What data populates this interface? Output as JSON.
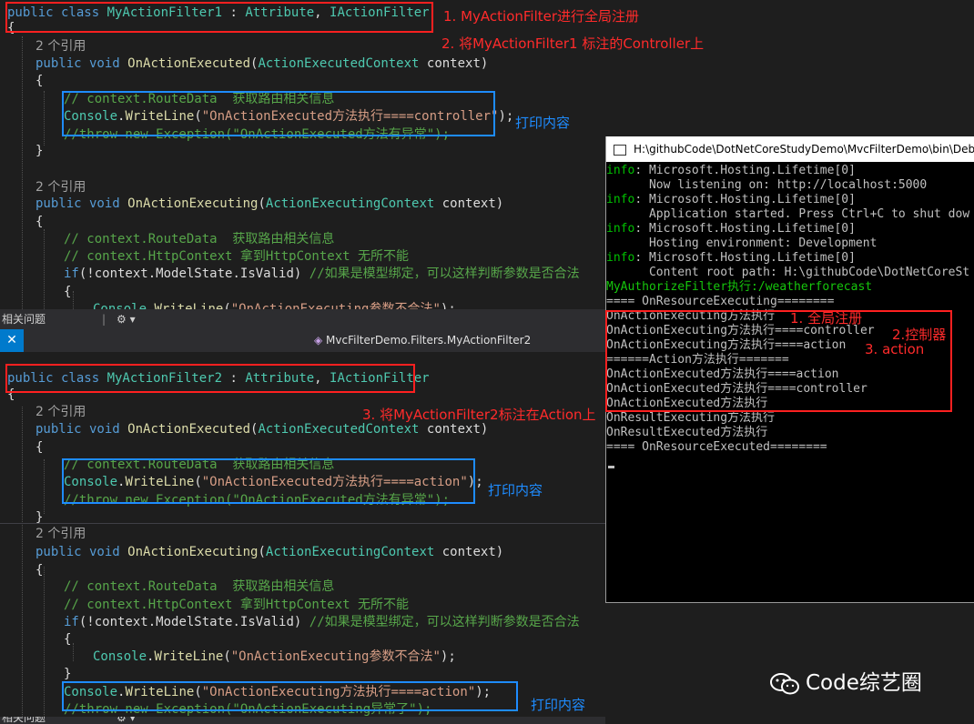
{
  "top_editor": {
    "lines": [
      {
        "kind": "decl",
        "tokens": [
          [
            "kw",
            "public class "
          ],
          [
            "ty",
            "MyActionFilter1"
          ],
          [
            "",
            " : "
          ],
          [
            "ty",
            "Attribute"
          ],
          [
            "",
            ", "
          ],
          [
            "ty",
            "IActionFilter"
          ]
        ]
      },
      {
        "kind": "code",
        "tokens": [
          [
            "",
            "{"
          ]
        ]
      },
      {
        "kind": "ref",
        "tokens": [
          [
            "ref",
            "2 个引用"
          ]
        ]
      },
      {
        "kind": "code",
        "tokens": [
          [
            "kw",
            "public void "
          ],
          [
            "fn",
            "OnActionExecuted"
          ],
          [
            "",
            "("
          ],
          [
            "ty",
            "ActionExecutedContext"
          ],
          [
            "",
            " context)"
          ]
        ]
      },
      {
        "kind": "code",
        "tokens": [
          [
            "",
            "{"
          ]
        ]
      },
      {
        "kind": "code",
        "tokens": [
          [
            "cm",
            "// context.RouteData  获取路由相关信息"
          ]
        ]
      },
      {
        "kind": "code",
        "tokens": [
          [
            "ty",
            "Console"
          ],
          [
            "",
            "."
          ],
          [
            "fn",
            "WriteLine"
          ],
          [
            "",
            "("
          ],
          [
            "st",
            "\"OnActionExecuted方法执行====controller\""
          ],
          [
            "",
            ");"
          ]
        ]
      },
      {
        "kind": "code",
        "tokens": [
          [
            "cm",
            "//throw new Exception(\"OnActionExecuted方法有异常\");"
          ]
        ]
      },
      {
        "kind": "code",
        "tokens": [
          [
            "",
            "}"
          ]
        ]
      },
      {
        "kind": "blank",
        "tokens": []
      },
      {
        "kind": "ref",
        "tokens": [
          [
            "ref",
            "2 个引用"
          ]
        ]
      },
      {
        "kind": "code",
        "tokens": [
          [
            "kw",
            "public void "
          ],
          [
            "fn",
            "OnActionExecuting"
          ],
          [
            "",
            "("
          ],
          [
            "ty",
            "ActionExecutingContext"
          ],
          [
            "",
            " context)"
          ]
        ]
      },
      {
        "kind": "code",
        "tokens": [
          [
            "",
            "{"
          ]
        ]
      },
      {
        "kind": "code",
        "tokens": [
          [
            "cm",
            "// context.RouteData  获取路由相关信息"
          ]
        ]
      },
      {
        "kind": "code",
        "tokens": [
          [
            "cm",
            "// context.HttpContext 拿到HttpContext 无所不能"
          ]
        ]
      },
      {
        "kind": "code",
        "tokens": [
          [
            "kw",
            "if"
          ],
          [
            "",
            "(!context."
          ],
          [
            "",
            "ModelState"
          ],
          [
            "",
            "."
          ],
          [
            "",
            "IsValid"
          ],
          [
            "",
            ") "
          ],
          [
            "cm",
            "//如果是模型绑定，可以这样判断参数是否合法"
          ]
        ]
      },
      {
        "kind": "code",
        "tokens": [
          [
            "",
            "{"
          ]
        ]
      },
      {
        "kind": "code",
        "tokens": [
          [
            "ty",
            "Console"
          ],
          [
            "",
            "."
          ],
          [
            "fn",
            "WriteLine"
          ],
          [
            "",
            "("
          ],
          [
            "st",
            "\"OnActionExecuting参数不合法\""
          ],
          [
            "",
            ");"
          ]
        ]
      }
    ]
  },
  "top_strip": {
    "label": "相关问题",
    "icons": "⚙ ▾"
  },
  "tab": {
    "close": "✕",
    "breadcrumb": "MvcFilterDemo.Filters.MyActionFilter2"
  },
  "bottom_editor": {
    "lines": [
      {
        "kind": "decl",
        "tokens": [
          [
            "kw",
            "public class "
          ],
          [
            "ty",
            "MyActionFilter2"
          ],
          [
            "",
            " : "
          ],
          [
            "ty",
            "Attribute"
          ],
          [
            "",
            ", "
          ],
          [
            "ty",
            "IActionFilter"
          ]
        ]
      },
      {
        "kind": "code",
        "tokens": [
          [
            "",
            "{"
          ]
        ]
      },
      {
        "kind": "ref",
        "tokens": [
          [
            "ref",
            "2 个引用"
          ]
        ]
      },
      {
        "kind": "code",
        "tokens": [
          [
            "kw",
            "public void "
          ],
          [
            "fn",
            "OnActionExecuted"
          ],
          [
            "",
            "("
          ],
          [
            "ty",
            "ActionExecutedContext"
          ],
          [
            "",
            " context)"
          ]
        ]
      },
      {
        "kind": "code",
        "tokens": [
          [
            "",
            "{"
          ]
        ]
      },
      {
        "kind": "code",
        "tokens": [
          [
            "cm",
            "// context.RouteData  获取路由相关信息"
          ]
        ]
      },
      {
        "kind": "code",
        "tokens": [
          [
            "ty",
            "Console"
          ],
          [
            "",
            "."
          ],
          [
            "fn",
            "WriteLine"
          ],
          [
            "",
            "("
          ],
          [
            "st",
            "\"OnActionExecuted方法执行====action\""
          ],
          [
            "",
            ");"
          ]
        ]
      },
      {
        "kind": "code",
        "tokens": [
          [
            "cm",
            "//throw new Exception(\"OnActionExecuted方法有异常\");"
          ]
        ]
      },
      {
        "kind": "code",
        "tokens": [
          [
            "",
            "}"
          ]
        ]
      },
      {
        "kind": "ref",
        "tokens": [
          [
            "ref",
            "2 个引用"
          ]
        ]
      },
      {
        "kind": "code",
        "tokens": [
          [
            "kw",
            "public void "
          ],
          [
            "fn",
            "OnActionExecuting"
          ],
          [
            "",
            "("
          ],
          [
            "ty",
            "ActionExecutingContext"
          ],
          [
            "",
            " context)"
          ]
        ]
      },
      {
        "kind": "code",
        "tokens": [
          [
            "",
            "{"
          ]
        ]
      },
      {
        "kind": "code",
        "tokens": [
          [
            "cm",
            "// context.RouteData  获取路由相关信息"
          ]
        ]
      },
      {
        "kind": "code",
        "tokens": [
          [
            "cm",
            "// context.HttpContext 拿到HttpContext 无所不能"
          ]
        ]
      },
      {
        "kind": "code",
        "tokens": [
          [
            "kw",
            "if"
          ],
          [
            "",
            "(!context."
          ],
          [
            "",
            "ModelState"
          ],
          [
            "",
            "."
          ],
          [
            "",
            "IsValid"
          ],
          [
            "",
            ") "
          ],
          [
            "cm",
            "//如果是模型绑定，可以这样判断参数是否合法"
          ]
        ]
      },
      {
        "kind": "code",
        "tokens": [
          [
            "",
            "{"
          ]
        ]
      },
      {
        "kind": "code",
        "tokens": [
          [
            "ty",
            "Console"
          ],
          [
            "",
            "."
          ],
          [
            "fn",
            "WriteLine"
          ],
          [
            "",
            "("
          ],
          [
            "st",
            "\"OnActionExecuting参数不合法\""
          ],
          [
            "",
            ");"
          ]
        ]
      },
      {
        "kind": "code",
        "tokens": [
          [
            "",
            "}"
          ]
        ]
      },
      {
        "kind": "code",
        "tokens": [
          [
            "ty",
            "Console"
          ],
          [
            "",
            "."
          ],
          [
            "fn",
            "WriteLine"
          ],
          [
            "",
            "("
          ],
          [
            "st",
            "\"OnActionExecuting方法执行====action\""
          ],
          [
            "",
            ");"
          ]
        ]
      },
      {
        "kind": "code",
        "tokens": [
          [
            "cm",
            "//throw new Exception(\"OnActionExecuting异常了\");"
          ]
        ]
      }
    ]
  },
  "bottom_strip": {
    "label": "相关问题",
    "icons": "⚙ ▾"
  },
  "annotations": {
    "a1": "1. MyActionFilter进行全局注册",
    "a2": "2. 将MyActionFilter1 标注的Controller上",
    "a3": "3. 将MyActionFilter2标注在Action上",
    "print1": "打印内容",
    "print2": "打印内容",
    "print3": "打印内容",
    "c1": "1. 全局注册",
    "c2": "2.控制器",
    "c3": "3. action"
  },
  "console": {
    "title": "H:\\githubCode\\DotNetCoreStudyDemo\\MvcFilterDemo\\bin\\Debu",
    "lines": [
      [
        [
          "info",
          "info"
        ],
        [
          "",
          ": Microsoft.Hosting.Lifetime[0]"
        ]
      ],
      [
        [
          "",
          "      Now listening on: http://localhost:5000"
        ]
      ],
      [
        [
          "info",
          "info"
        ],
        [
          "",
          ": Microsoft.Hosting.Lifetime[0]"
        ]
      ],
      [
        [
          "",
          "      Application started. Press Ctrl+C to shut dow"
        ]
      ],
      [
        [
          "info",
          "info"
        ],
        [
          "",
          ": Microsoft.Hosting.Lifetime[0]"
        ]
      ],
      [
        [
          "",
          "      Hosting environment: Development"
        ]
      ],
      [
        [
          "info",
          "info"
        ],
        [
          "",
          ": Microsoft.Hosting.Lifetime[0]"
        ]
      ],
      [
        [
          "",
          "      Content root path: H:\\githubCode\\DotNetCoreSt"
        ]
      ],
      [
        [
          "green",
          "MyAuthorizeFilter执行:/weatherforecast"
        ]
      ],
      [
        [
          "",
          "==== OnResourceExecuting========"
        ]
      ],
      [
        [
          "",
          "OnActionExecuting方法执行"
        ]
      ],
      [
        [
          "",
          "OnActionExecuting方法执行====controller"
        ]
      ],
      [
        [
          "",
          "OnActionExecuting方法执行====action"
        ]
      ],
      [
        [
          "",
          "======Action方法执行======="
        ]
      ],
      [
        [
          "",
          "OnActionExecuted方法执行====action"
        ]
      ],
      [
        [
          "",
          "OnActionExecuted方法执行====controller"
        ]
      ],
      [
        [
          "",
          "OnActionExecuted方法执行"
        ]
      ],
      [
        [
          "",
          "OnResultExecuting方法执行"
        ]
      ],
      [
        [
          "",
          "OnResultExecuted方法执行"
        ]
      ],
      [
        [
          "",
          "==== OnResourceExecuted========"
        ]
      ]
    ]
  },
  "watermark": {
    "text": "Code综艺圈"
  },
  "colors": {
    "keyword": "#569cd6",
    "type": "#4ec9b0",
    "comment": "#57a64a",
    "string": "#d69d85",
    "red_box": "#ff2020",
    "blue_box": "#1e8cff"
  }
}
